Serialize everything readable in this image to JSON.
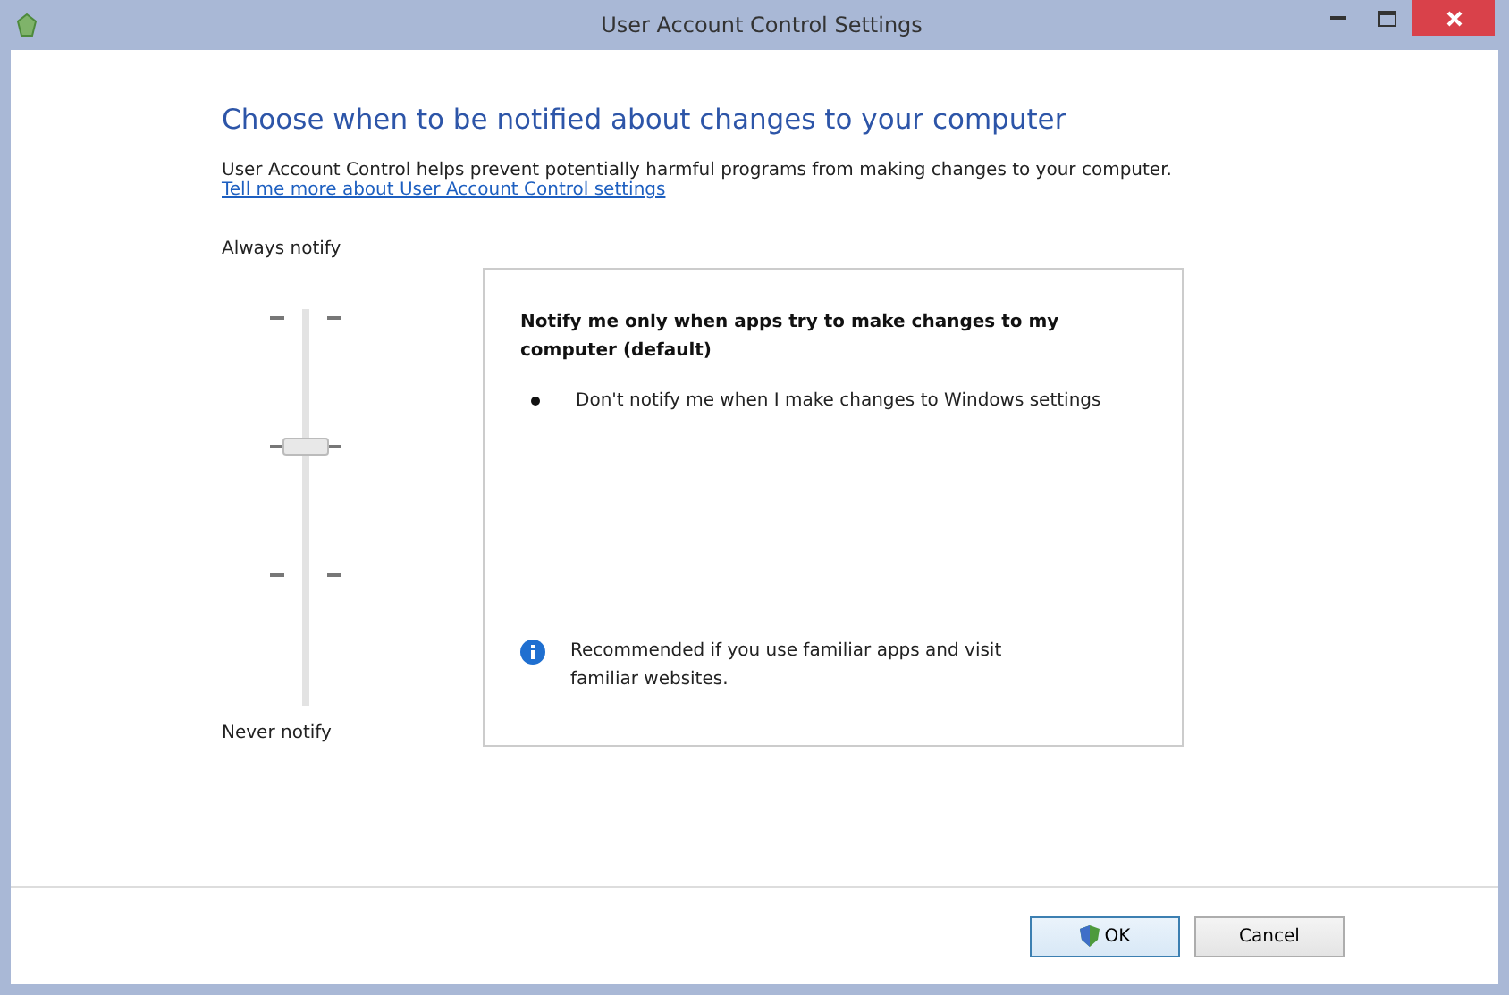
{
  "window": {
    "title": "User Account Control Settings"
  },
  "heading": "Choose when to be notified about changes to your computer",
  "description": "User Account Control helps prevent potentially harmful programs from making changes to your computer.",
  "link": "Tell me more about User Account Control settings",
  "slider": {
    "top_label": "Always notify",
    "bottom_label": "Never notify",
    "level": 0.667
  },
  "panel": {
    "title": "Notify me only when apps try to make changes to my computer (default)",
    "bullets": [
      "Don't notify me when I make changes to Windows settings"
    ],
    "note": "Recommended if you use familiar apps and visit familiar websites."
  },
  "buttons": [
    {
      "label": "OK",
      "kind": "shield"
    },
    {
      "label": "Cancel",
      "kind": "plain"
    }
  ]
}
